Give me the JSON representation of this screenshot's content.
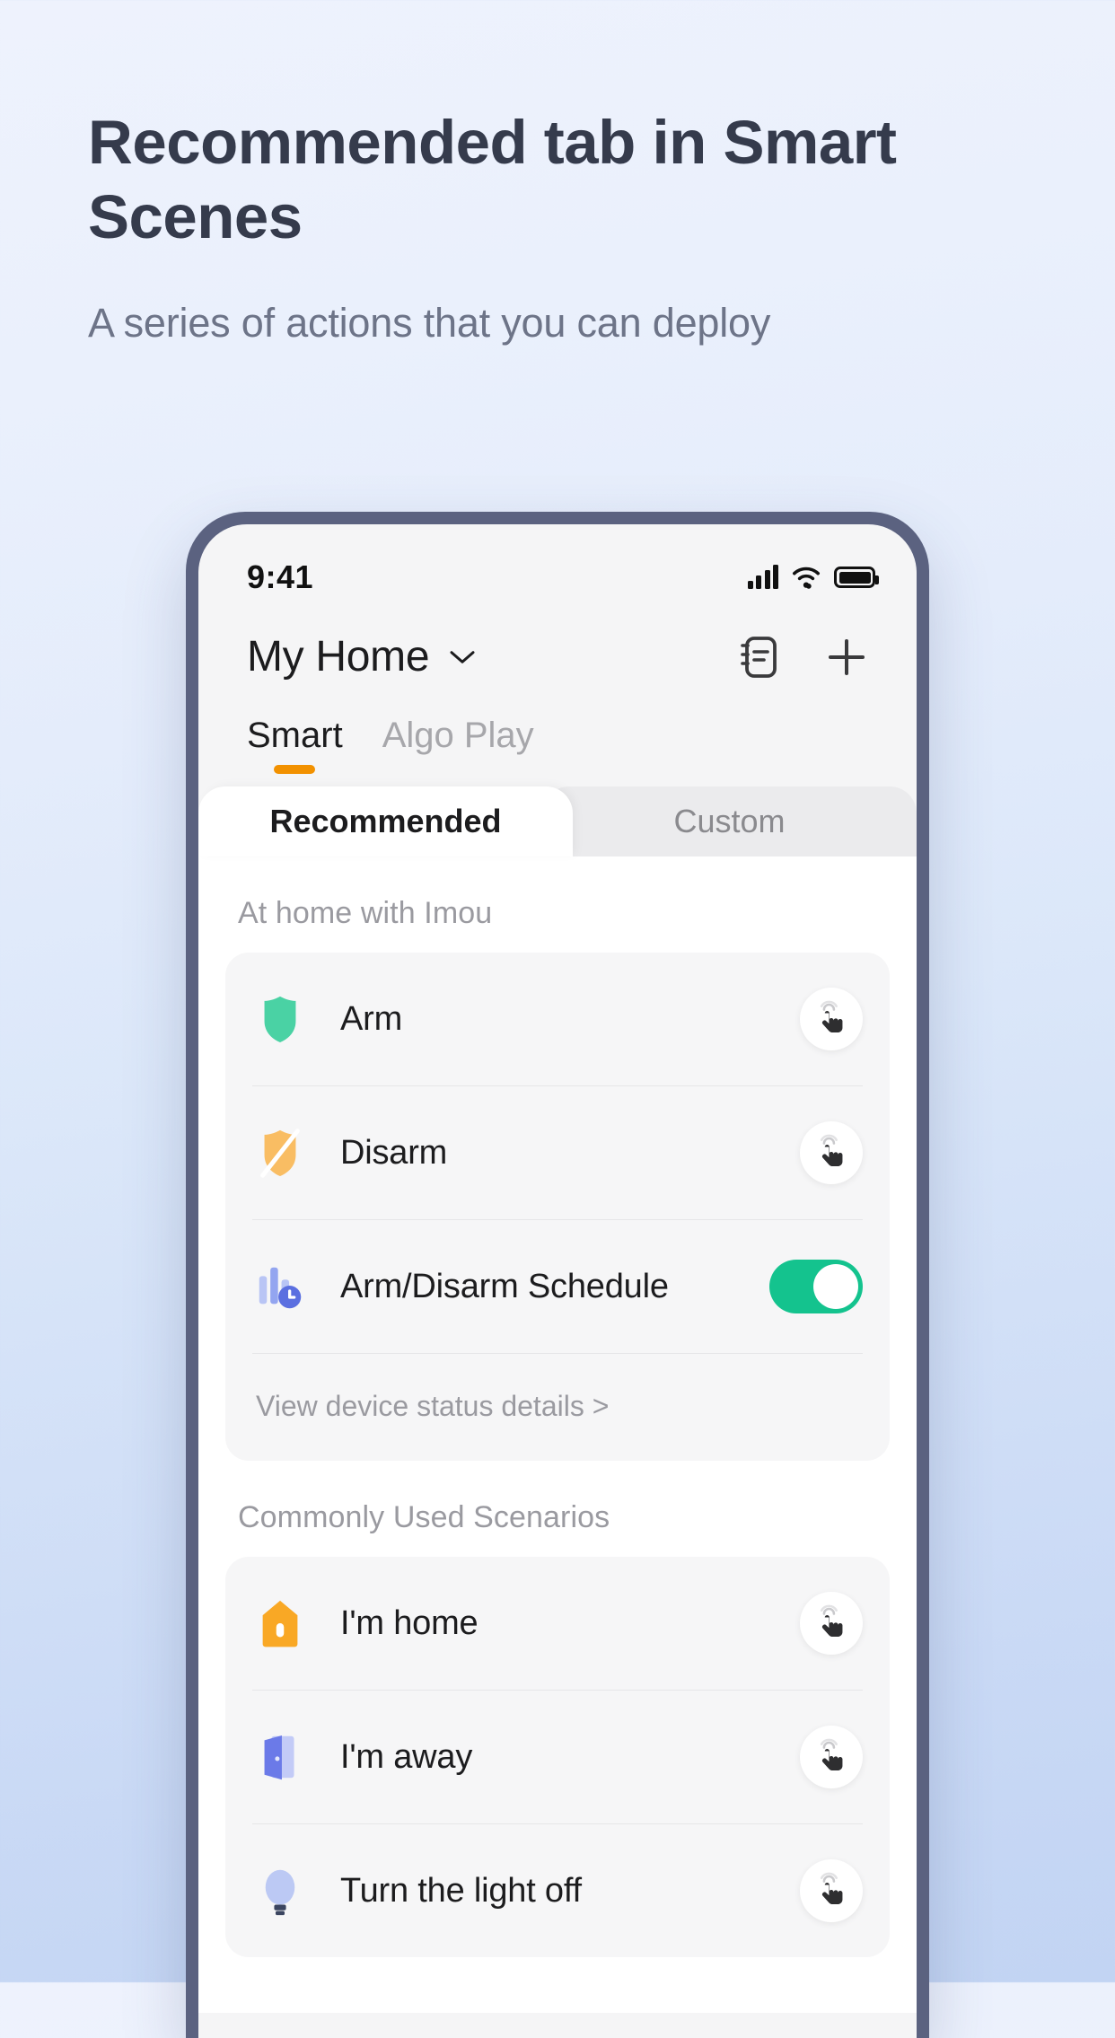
{
  "promo": {
    "title": "Recommended tab in Smart Scenes",
    "subtitle": "A series of actions that you can deploy"
  },
  "phone": {
    "status_bar": {
      "time": "9:41",
      "signal_icon": "cellular-signal-icon",
      "wifi_icon": "wifi-icon",
      "battery_icon": "battery-full-icon"
    },
    "app_bar": {
      "home_title": "My Home",
      "chevron_icon": "chevron-down-icon",
      "log_icon": "notebook-icon",
      "add_icon": "plus-icon"
    },
    "segment_tabs": [
      {
        "label": "Smart",
        "active": true
      },
      {
        "label": "Algo Play",
        "active": false
      }
    ],
    "pill_tabs": [
      {
        "label": "Recommended",
        "active": true
      },
      {
        "label": "Custom",
        "active": false
      }
    ],
    "sections": [
      {
        "label": "At home with Imou",
        "rows": [
          {
            "label": "Arm",
            "icon": "shield-icon",
            "control": "tap"
          },
          {
            "label": "Disarm",
            "icon": "shield-off-icon",
            "control": "tap"
          },
          {
            "label": "Arm/Disarm Schedule",
            "icon": "schedule-clock-icon",
            "control": "toggle",
            "toggle_on": true
          }
        ],
        "link": "View device status details >"
      },
      {
        "label": "Commonly Used Scenarios",
        "rows": [
          {
            "label": "I'm home",
            "icon": "house-icon",
            "control": "tap"
          },
          {
            "label": "I'm away",
            "icon": "door-icon",
            "control": "tap"
          },
          {
            "label": "Turn the light off",
            "icon": "lightbulb-icon",
            "control": "tap"
          }
        ]
      }
    ]
  },
  "colors": {
    "accent_orange": "#f29100",
    "toggle_green": "#14c38e",
    "shield_green": "#4bd0a0",
    "shield_orange": "#f9b95a",
    "house_orange": "#f9a825",
    "door_blue": "#7b87e8",
    "bulb_blue": "#b9c7f2",
    "schedule_blue": "#8f9ff0",
    "phone_bezel": "#5b6280"
  }
}
